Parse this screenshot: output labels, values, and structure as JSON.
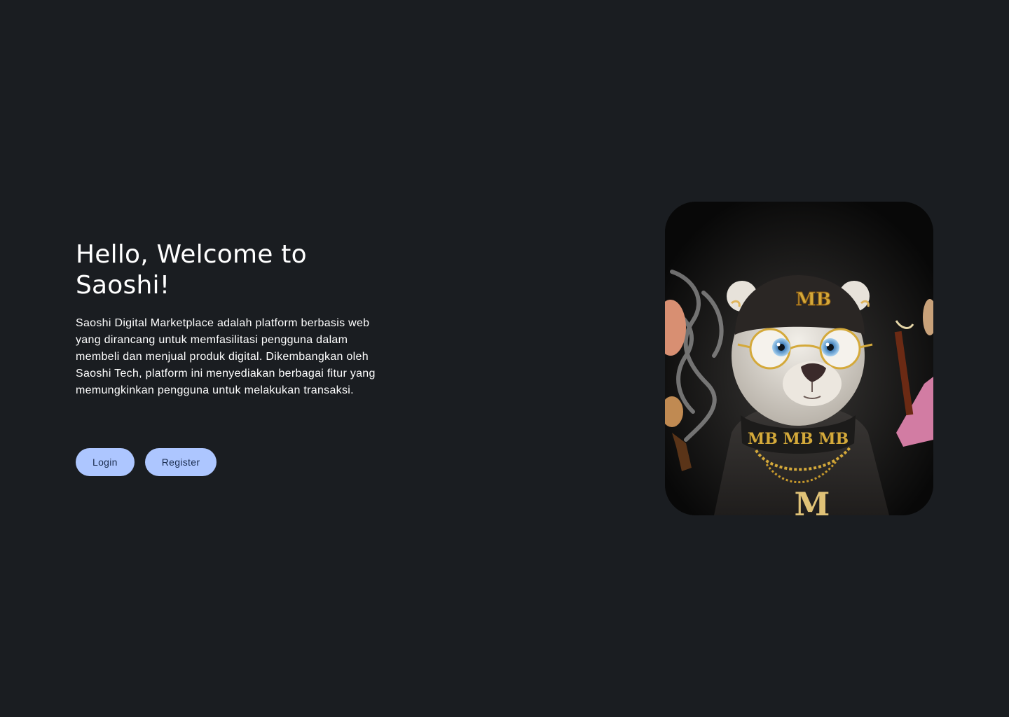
{
  "hero": {
    "title": "Hello, Welcome to Saoshi!",
    "description": "Saoshi Digital Marketplace adalah platform berbasis web yang dirancang untuk memfasilitasi pengguna dalam membeli dan menjual produk digital. Dikembangkan oleh Saoshi Tech, platform ini menyediakan berbagai fitur yang memungkinkan pengguna untuk melakukan transaksi."
  },
  "actions": {
    "login_label": "Login",
    "register_label": "Register"
  },
  "illustration": {
    "icon": "bear-nft-illustration",
    "beanie_text": "MB",
    "collar_text": "MB MB MB",
    "pendant_text": "M"
  },
  "colors": {
    "background": "#1a1d21",
    "button_bg": "#adc6ff",
    "button_text": "#1b2d4f",
    "accent_gold": "#d4a93a"
  }
}
